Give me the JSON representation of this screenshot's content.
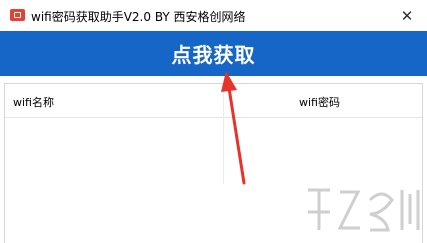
{
  "window": {
    "title": "wifi密码获取助手V2.0  BY  西安格创网络",
    "icon": "app-icon",
    "close_glyph": "✕"
  },
  "action": {
    "label": "点我获取",
    "color": "#1566c7"
  },
  "table": {
    "columns": [
      "wifi名称",
      "wifi密码"
    ],
    "rows": []
  },
  "annotation": {
    "color": "#e8332c"
  }
}
